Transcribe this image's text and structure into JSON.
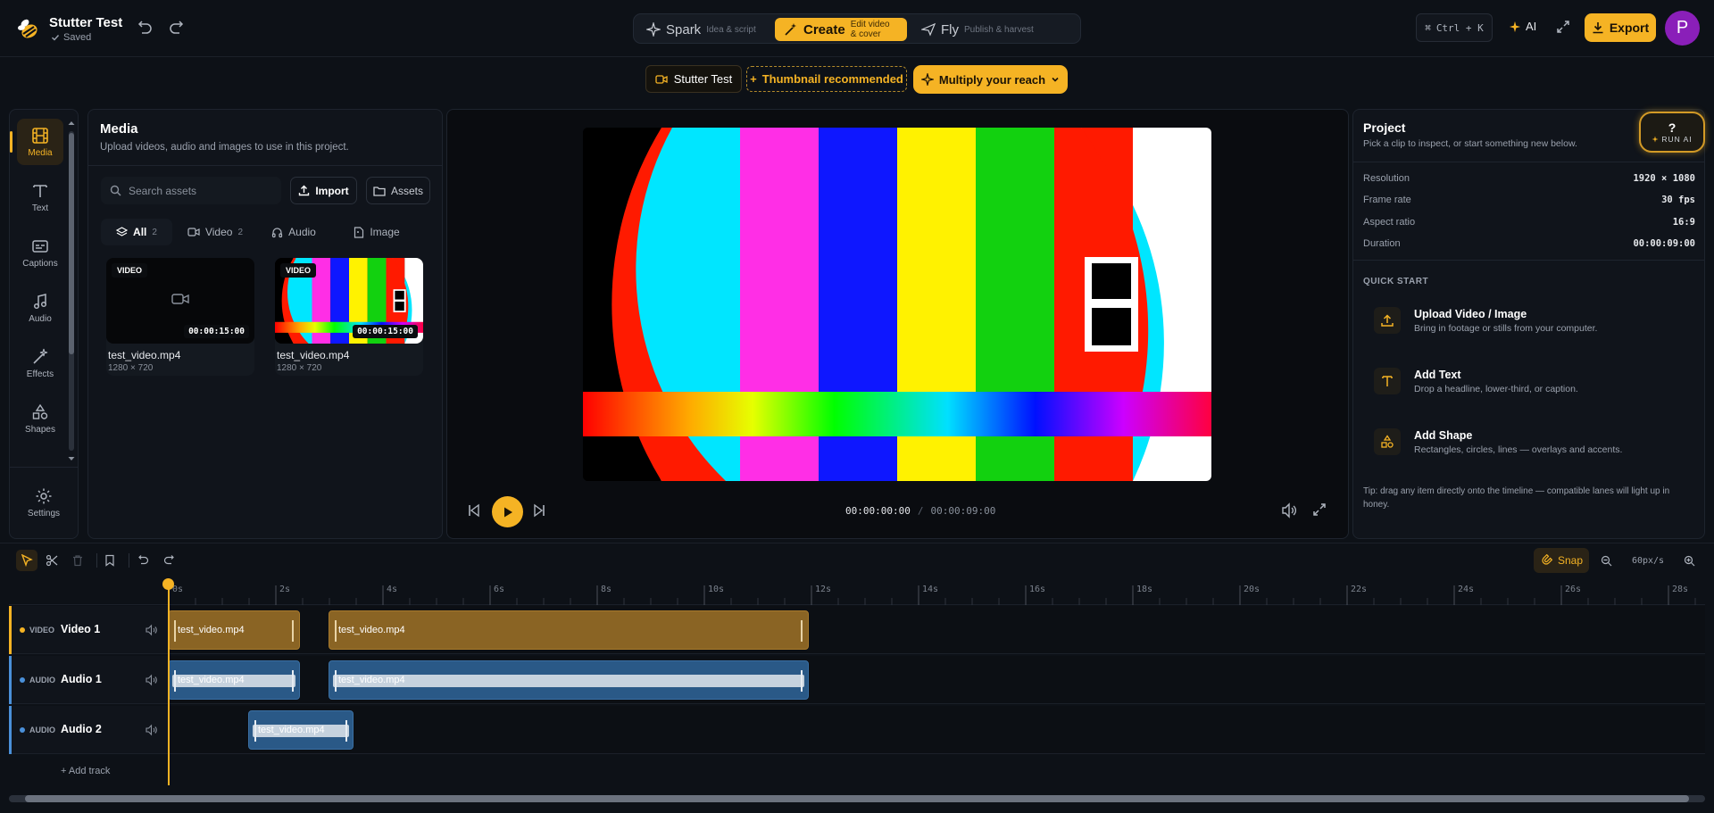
{
  "header": {
    "project_title": "Stutter Test",
    "status": "Saved",
    "modes": [
      {
        "name": "Spark",
        "sub": "Idea & script"
      },
      {
        "name": "Create",
        "sub": "Edit video & cover"
      },
      {
        "name": "Fly",
        "sub": "Publish & harvest"
      }
    ],
    "shortcut": "Ctrl + K",
    "ai_label": "AI",
    "export_label": "Export",
    "avatar_letter": "P"
  },
  "subbar": {
    "project_chip": "Stutter Test",
    "thumbnail_chip": "Thumbnail recommended",
    "reach_button": "Multiply your reach"
  },
  "rail": {
    "items": [
      {
        "label": "Media",
        "icon": "film-icon"
      },
      {
        "label": "Text",
        "icon": "text-icon"
      },
      {
        "label": "Captions",
        "icon": "captions-icon"
      },
      {
        "label": "Audio",
        "icon": "music-icon"
      },
      {
        "label": "Effects",
        "icon": "wand-icon"
      },
      {
        "label": "Shapes",
        "icon": "shapes-icon"
      }
    ],
    "settings_label": "Settings"
  },
  "media": {
    "title": "Media",
    "subtitle": "Upload videos, audio and images to use in this project.",
    "search_placeholder": "Search assets",
    "import_label": "Import",
    "assets_label": "Assets",
    "filters": [
      {
        "label": "All",
        "count": "2"
      },
      {
        "label": "Video",
        "count": "2"
      },
      {
        "label": "Audio",
        "count": ""
      },
      {
        "label": "Image",
        "count": ""
      }
    ],
    "assets": [
      {
        "badge": "VIDEO",
        "duration": "00:00:15:00",
        "name": "test_video.mp4",
        "resolution": "1280 × 720"
      },
      {
        "badge": "VIDEO",
        "duration": "00:00:15:00",
        "name": "test_video.mp4",
        "resolution": "1280 × 720"
      }
    ]
  },
  "preview": {
    "current_time": "00:00:00:00",
    "separator": "/",
    "total_time": "00:00:09:00"
  },
  "project": {
    "title": "Project",
    "subtitle": "Pick a clip to inspect, or start something new below.",
    "run_ai_symbol": "?",
    "run_ai_label": "RUN AI",
    "props": [
      {
        "key": "Resolution",
        "value": "1920 × 1080"
      },
      {
        "key": "Frame rate",
        "value": "30 fps"
      },
      {
        "key": "Aspect ratio",
        "value": "16:9"
      },
      {
        "key": "Duration",
        "value": "00:00:09:00"
      }
    ],
    "quick_start_title": "QUICK START",
    "quick_start": [
      {
        "title": "Upload Video / Image",
        "desc": "Bring in footage or stills from your computer.",
        "icon": "upload-icon"
      },
      {
        "title": "Add Text",
        "desc": "Drop a headline, lower-third, or caption.",
        "icon": "text-icon"
      },
      {
        "title": "Add Shape",
        "desc": "Rectangles, circles, lines — overlays and accents.",
        "icon": "shapes-icon"
      }
    ],
    "tip": "Tip: drag any item directly onto the timeline — compatible lanes will light up in honey."
  },
  "timeline": {
    "snap_label": "Snap",
    "zoom_value": "60px/s",
    "ruler_labels": [
      "0s",
      "2s",
      "4s",
      "6s",
      "8s",
      "10s",
      "12s",
      "14s",
      "16s",
      "18s",
      "20s",
      "22s",
      "24s",
      "26s",
      "28s"
    ],
    "tracks": [
      {
        "type": "VIDEO",
        "name": "Video 1",
        "color": "#f5b324"
      },
      {
        "type": "AUDIO",
        "name": "Audio 1",
        "color": "#4a90d9"
      },
      {
        "type": "AUDIO",
        "name": "Audio 2",
        "color": "#4a90d9"
      }
    ],
    "clips": [
      {
        "track": 0,
        "label": "test_video.mp4",
        "start_s": 0,
        "end_s": 2.5
      },
      {
        "track": 0,
        "label": "test_video.mp4",
        "start_s": 3.0,
        "end_s": 12.0
      },
      {
        "track": 1,
        "label": "test_video.mp4",
        "start_s": 0,
        "end_s": 2.5
      },
      {
        "track": 1,
        "label": "test_video.mp4",
        "start_s": 3.0,
        "end_s": 12.0
      },
      {
        "track": 2,
        "label": "test_video.mp4",
        "start_s": 1.5,
        "end_s": 3.5
      }
    ],
    "add_track_label": "+ Add track"
  },
  "colors": {
    "accent": "#f5b324",
    "background": "#0d1117",
    "panel": "#10141b",
    "video_clip": "#8a6424",
    "audio_clip": "#2a5987"
  }
}
